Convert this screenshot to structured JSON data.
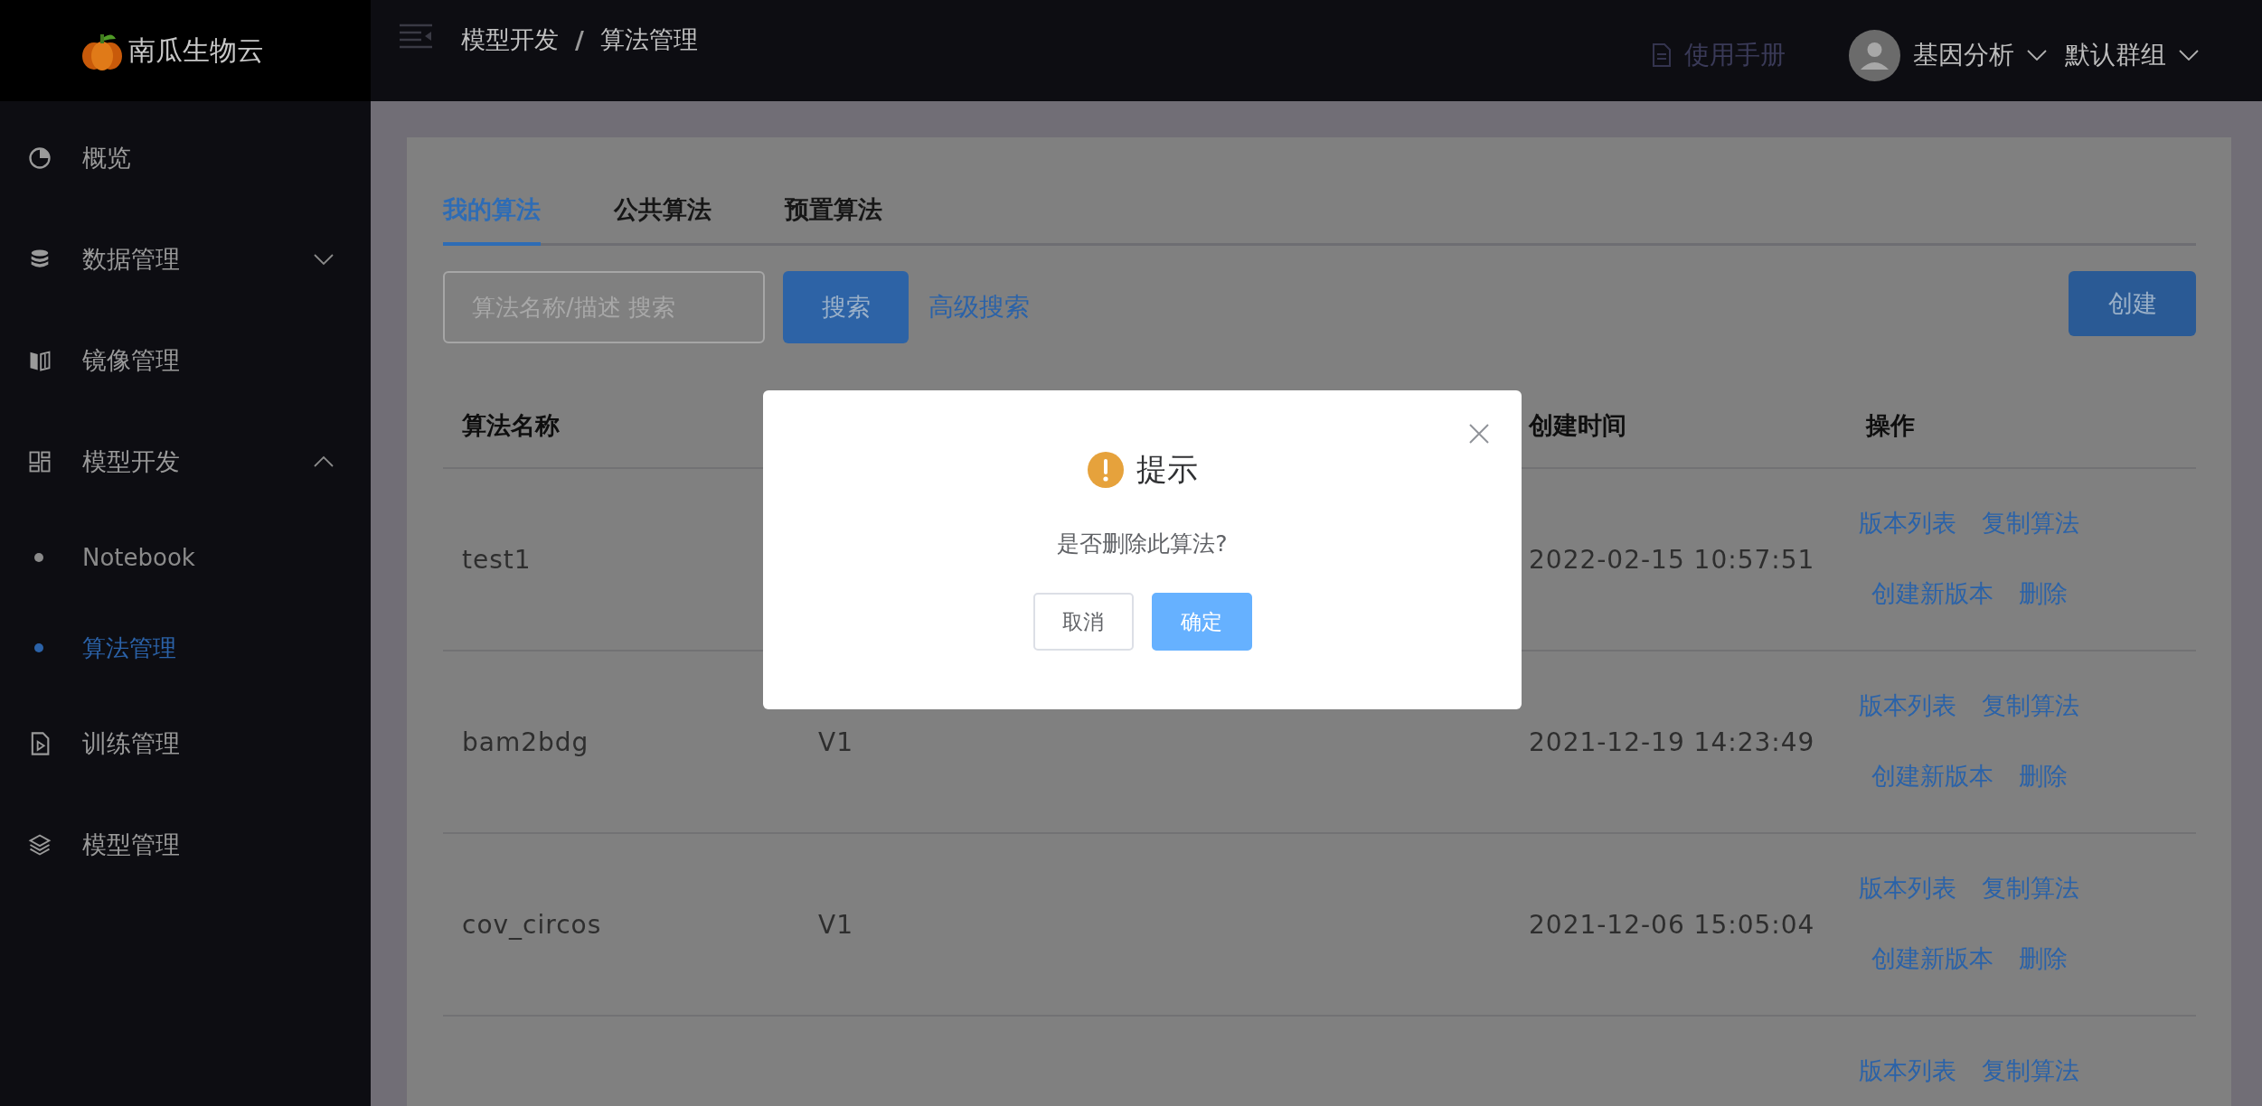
{
  "logo": {
    "text": "南瓜生物云"
  },
  "header": {
    "breadcrumb": [
      "模型开发",
      "算法管理"
    ],
    "separator": "/",
    "manual": "使用手册",
    "user": "基因分析",
    "group": "默认群组"
  },
  "sidebar": {
    "items": [
      {
        "label": "概览",
        "selected": false
      },
      {
        "label": "数据管理",
        "selected": false,
        "expanded": false
      },
      {
        "label": "镜像管理",
        "selected": false
      },
      {
        "label": "模型开发",
        "selected": false,
        "expanded": true,
        "children": [
          {
            "label": "Notebook",
            "selected": false
          },
          {
            "label": "算法管理",
            "selected": true
          }
        ]
      },
      {
        "label": "训练管理",
        "selected": false
      },
      {
        "label": "模型管理",
        "selected": false
      }
    ]
  },
  "tabs": [
    {
      "label": "我的算法",
      "selected": true
    },
    {
      "label": "公共算法",
      "selected": false
    },
    {
      "label": "预置算法",
      "selected": false
    }
  ],
  "search": {
    "placeholder": "算法名称/描述 搜索",
    "button": "搜索",
    "advanced": "高级搜索",
    "create": "创建"
  },
  "table": {
    "columns": {
      "name": "算法名称",
      "created": "创建时间",
      "actions": "操作"
    },
    "rows": [
      {
        "name": "test1",
        "created": "2022-02-15 10:57:51",
        "actions": [
          "版本列表",
          "复制算法",
          "创建新版本",
          "删除"
        ]
      },
      {
        "name": "bam2bdg",
        "version": "V1",
        "created": "2021-12-19 14:23:49",
        "actions": [
          "版本列表",
          "复制算法",
          "创建新版本",
          "删除"
        ]
      },
      {
        "name": "cov_circos",
        "version": "V1",
        "created": "2021-12-06 15:05:04",
        "actions": [
          "版本列表",
          "复制算法",
          "创建新版本",
          "删除"
        ]
      },
      {
        "actions": [
          "版本列表",
          "复制算法"
        ]
      }
    ]
  },
  "dialog": {
    "title": "提示",
    "message": "是否删除此算法?",
    "cancel": "取消",
    "confirm": "确定"
  }
}
